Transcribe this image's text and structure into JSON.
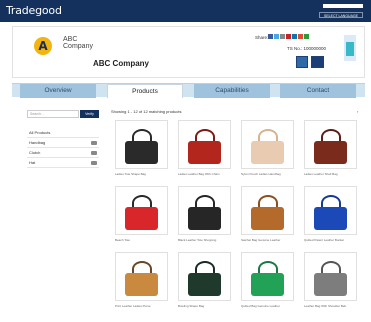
{
  "app": {
    "logo": "Tradegood",
    "language_label": "SELECT LANGUAGE"
  },
  "company": {
    "brand_line1": "ABC",
    "brand_line2": "Company",
    "name": "ABC Company",
    "share_label": "Share:",
    "tel": "TS No.: 100000000"
  },
  "tabs": [
    {
      "label": "Overview"
    },
    {
      "label": "Products"
    },
    {
      "label": "Capabilities"
    },
    {
      "label": "Contact"
    }
  ],
  "sidebar": {
    "search_placeholder": "Search...",
    "search_button": "Verify",
    "categories": [
      {
        "label": "All Products"
      },
      {
        "label": "Handbag"
      },
      {
        "label": "Clutch"
      },
      {
        "label": "Hat"
      }
    ]
  },
  "listing": {
    "showing": "Showing 1 - 12 of 12 matching products",
    "next": "›"
  },
  "products": [
    {
      "caption": "Ladies Tote Shape Bag",
      "color": "#2a2a2a",
      "handle": "#2a2a2a"
    },
    {
      "caption": "Ladies Leather Bag With Chain",
      "color": "#b3261e",
      "handle": "#7d1a14"
    },
    {
      "caption": "Nylon Pouch Ladies Handbag",
      "color": "#e8cbb0",
      "handle": "#d7b392"
    },
    {
      "caption": "Ladies Leather Shell Bag",
      "color": "#7a2b1c",
      "handle": "#5a1f14"
    },
    {
      "caption": "Beach Tote",
      "color": "#d9262b",
      "handle": "#2a2a2a"
    },
    {
      "caption": "Black Leather Tote Shopping",
      "color": "#262626",
      "handle": "#262626"
    },
    {
      "caption": "Satchel Bag Genuine Leather",
      "color": "#b46a2a",
      "handle": "#8c4f1d"
    },
    {
      "caption": "Quilted Patent Leather Bucket",
      "color": "#1c49b8",
      "handle": "#153a92"
    },
    {
      "caption": "Print Leather Ladies Purse",
      "color": "#c9893f",
      "handle": "#6a4424"
    },
    {
      "caption": "Bowling Shape Bag",
      "color": "#1f3a2c",
      "handle": "#172b21"
    },
    {
      "caption": "Quilted Bag Genuine Leather",
      "color": "#22a257",
      "handle": "#197a41"
    },
    {
      "caption": "Leather Bag With Shoulder Belt",
      "color": "#7d7d7d",
      "handle": "#555555"
    }
  ],
  "colors": {
    "nav": "#13315c",
    "tab_bg": "#9fc2dd",
    "accent": "#f2b410"
  }
}
